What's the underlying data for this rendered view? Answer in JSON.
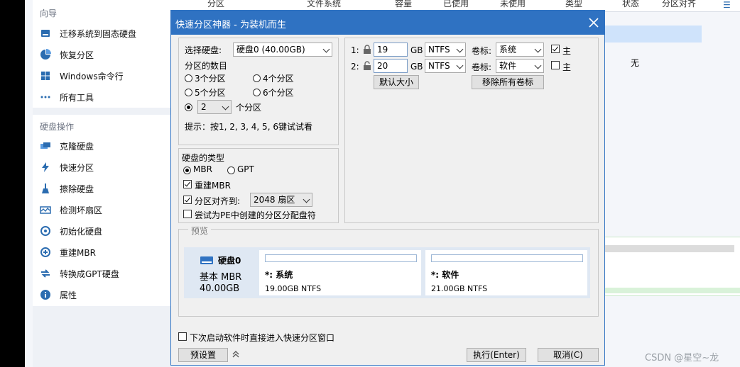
{
  "background": {
    "sidebar": {
      "section1_title": "向导",
      "items1": [
        {
          "label": "迁移系统到固态硬盘",
          "icon": "ssd-icon"
        },
        {
          "label": "恢复分区",
          "icon": "pie-recover-icon"
        },
        {
          "label": "Windows命令行",
          "icon": "windows-icon"
        },
        {
          "label": "所有工具",
          "icon": "more-icon"
        }
      ],
      "section2_title": "硬盘操作",
      "items2": [
        {
          "label": "克隆硬盘",
          "icon": "clone-disk-icon"
        },
        {
          "label": "快速分区",
          "icon": "lightning-icon"
        },
        {
          "label": "擦除硬盘",
          "icon": "broom-icon"
        },
        {
          "label": "检测坏扇区",
          "icon": "scan-icon"
        },
        {
          "label": "初始化硬盘",
          "icon": "init-disk-icon"
        },
        {
          "label": "重建MBR",
          "icon": "rebuild-mbr-icon"
        },
        {
          "label": "转换成GPT硬盘",
          "icon": "convert-gpt-icon"
        },
        {
          "label": "属性",
          "icon": "info-icon"
        }
      ]
    },
    "table_headers": [
      "分区",
      "文件系统",
      "容量",
      "已使用",
      "未使用",
      "类型",
      "状态",
      "分区对齐"
    ],
    "row_status": "无",
    "watermark": "CSDN @星空~龙"
  },
  "dialog": {
    "title": "快速分区神器 - 为装机而生",
    "select_disk_label": "选择硬盘:",
    "select_disk_value": "硬盘0 (40.00GB)",
    "partition_count_label": "分区的数目",
    "partition_options": [
      "3个分区",
      "4个分区",
      "5个分区",
      "6个分区"
    ],
    "custom_count_value": "2",
    "custom_count_suffix": "个分区",
    "hint": "提示：按1, 2, 3, 4, 5, 6键试试看",
    "disk_type_label": "硬盘的类型",
    "mbr_label": "MBR",
    "gpt_label": "GPT",
    "rebuild_mbr_label": "重建MBR",
    "align_label": "分区对齐到:",
    "align_value": "2048 扇区",
    "pe_assign_label": "尝试为PE中创建的分区分配盘符",
    "partitions": [
      {
        "index": "1:",
        "size": "19",
        "unit": "GB",
        "fs": "NTFS",
        "vol_label": "卷标:",
        "vol_value": "系统",
        "primary_checked": true,
        "primary_label": "主"
      },
      {
        "index": "2:",
        "size": "20",
        "unit": "GB",
        "fs": "NTFS",
        "vol_label": "卷标:",
        "vol_value": "软件",
        "primary_checked": false,
        "primary_label": "主"
      }
    ],
    "default_size_btn": "默认大小",
    "remove_labels_btn": "移除所有卷标",
    "preview_label": "预览",
    "preview_disk": {
      "name": "硬盘0",
      "type_label": "基本 MBR",
      "size": "40.00GB"
    },
    "preview_parts": [
      {
        "name": "*: 系统",
        "info": "19.00GB NTFS"
      },
      {
        "name": "*: 软件",
        "info": "21.00GB NTFS"
      }
    ],
    "startup_check_label": "下次启动软件时直接进入快速分区窗口",
    "preset_btn": "预设置",
    "execute_btn": "执行(Enter)",
    "cancel_btn": "取消(C)"
  }
}
